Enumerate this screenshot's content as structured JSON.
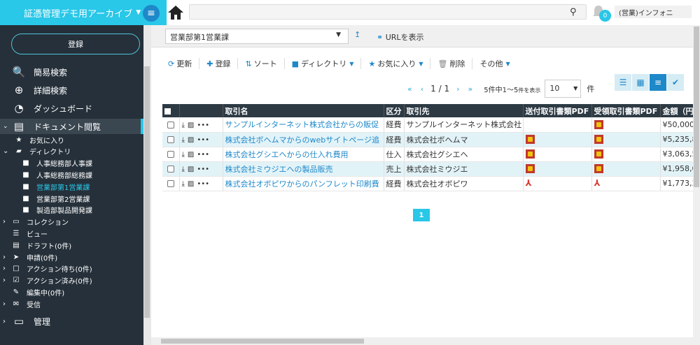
{
  "app": {
    "title": "証憑管理デモ用アーカイブ"
  },
  "header": {
    "notif_count": "0",
    "user_name": "(営業)インフォニ"
  },
  "sidebar": {
    "register": "登録",
    "items": [
      {
        "label": "簡易検索",
        "icon": "search-icon"
      },
      {
        "label": "詳細検索",
        "icon": "zoom-in-icon"
      },
      {
        "label": "ダッシュボード",
        "icon": "dashboard-icon"
      },
      {
        "label": "ドキュメント閲覧",
        "icon": "document-icon"
      }
    ],
    "tree": [
      {
        "label": "お気に入り",
        "icon": "star-icon",
        "level": 1
      },
      {
        "label": "ディレクトリ",
        "icon": "folder-open-icon",
        "level": 1
      },
      {
        "label": "人事総務部人事課",
        "icon": "folder-icon",
        "level": 2
      },
      {
        "label": "人事総務部総務課",
        "icon": "folder-icon",
        "level": 2
      },
      {
        "label": "営業部第1営業課",
        "icon": "folder-icon",
        "level": 2,
        "selected": true
      },
      {
        "label": "営業部第2営業課",
        "icon": "folder-icon",
        "level": 2
      },
      {
        "label": "製造部製品開発課",
        "icon": "folder-icon",
        "level": 2
      },
      {
        "label": "コレクション",
        "icon": "inbox-icon",
        "level": 0
      },
      {
        "label": "ビュー",
        "icon": "list-icon",
        "level": 0
      },
      {
        "label": "ドラフト(0件)",
        "icon": "draft-icon",
        "level": 0
      },
      {
        "label": "申請(0件)",
        "icon": "send-icon",
        "level": 0
      },
      {
        "label": "アクション待ち(0件)",
        "icon": "square-icon",
        "level": 0
      },
      {
        "label": "アクション済み(0件)",
        "icon": "check-square-icon",
        "level": 0
      },
      {
        "label": "編集中(0件)",
        "icon": "edit-icon",
        "level": 0
      },
      {
        "label": "受信",
        "icon": "mail-icon",
        "level": 0
      }
    ],
    "admin": "管理"
  },
  "crumb": {
    "folder": "営業部第1営業課",
    "url_label": "URLを表示"
  },
  "toolbar": {
    "refresh": "更新",
    "register": "登録",
    "sort": "ソート",
    "directory": "ディレクトリ",
    "favorite": "お気に入り",
    "delete": "削除",
    "other": "その他"
  },
  "pager": {
    "page": "1 / 1",
    "info_a": "5件中1〜5",
    "info_b": "件を表示",
    "per_page": "10",
    "unit": "件"
  },
  "table": {
    "headers": [
      "取引名",
      "区分",
      "取引先",
      "送付取引書類PDF",
      "受領取引書類PDF",
      "金額（円"
    ],
    "rows": [
      {
        "name": "サンプルインターネット株式会社からの販促",
        "kubun": "経費",
        "partner": "サンプルインターネット株式会社",
        "send": "",
        "recv": "pdf-red",
        "amount": "¥50,000"
      },
      {
        "name": "株式会社ボヘムマからのwebサイトページ追",
        "kubun": "経費",
        "partner": "株式会社ボヘムマ",
        "send": "pdf-red",
        "recv": "pdf-red",
        "amount": "¥5,235,8"
      },
      {
        "name": "株式会社グシエヘからの仕入れ費用",
        "kubun": "仕入",
        "partner": "株式会社グシエヘ",
        "send": "pdf-red",
        "recv": "pdf-red",
        "amount": "¥3,063,5"
      },
      {
        "name": "株式会社ミウジエへの製品販売",
        "kubun": "売上",
        "partner": "株式会社ミウジエ",
        "send": "pdf-red",
        "recv": "pdf-red",
        "amount": "¥1,958,0"
      },
      {
        "name": "株式会社オボピワからのパンフレット印刷費",
        "kubun": "経費",
        "partner": "株式会社オボピワ",
        "send": "pdf-adobe",
        "recv": "pdf-adobe",
        "amount": "¥1,773,3"
      }
    ]
  },
  "pagination": {
    "current": "1"
  },
  "colors": {
    "accent": "#29c7e8",
    "sidebar": "#25303a",
    "link": "#1e88c9",
    "header_row": "#2d3a44"
  }
}
